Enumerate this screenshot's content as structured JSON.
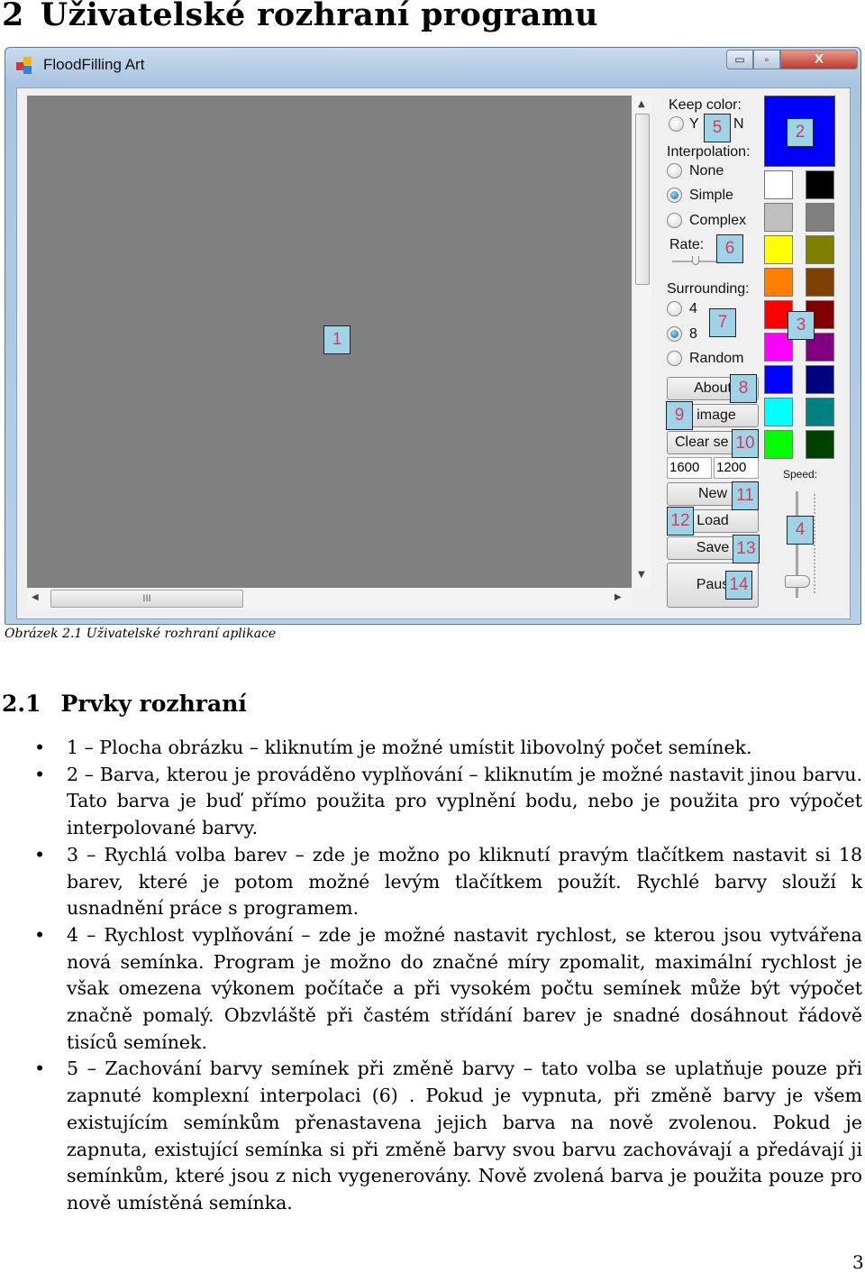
{
  "heading": {
    "number": "2",
    "text": "Uživatelské rozhraní programu"
  },
  "window": {
    "title": "FloodFilling Art",
    "minimize": "▭",
    "maximize": "▫",
    "close": "X",
    "keep_color_label": "Keep color:",
    "keep_y": "Y",
    "keep_n": "N",
    "keep_selected": "none",
    "interpolation_label": "Interpolation:",
    "interp_options": [
      "None",
      "Simple",
      "Complex"
    ],
    "interp_selected": "Simple",
    "rate_label": "Rate:",
    "surrounding_label": "Surrounding:",
    "surround_options": [
      "4",
      "8",
      "Random"
    ],
    "surround_selected": "8",
    "buttons": {
      "about": "About",
      "image": "l image",
      "clear": "Clear se",
      "new": "New",
      "load": "Load",
      "save": "Save",
      "pause": "Paus"
    },
    "width_value": "1600",
    "height_value": "1200",
    "speed_label": "Speed:",
    "hscroll_grip": "III",
    "current_color": "#0000ff",
    "swatches": [
      "#ffffff",
      "#000000",
      "#c0c0c0",
      "#808080",
      "#ffff00",
      "#808000",
      "#ff8000",
      "#804000",
      "#ff0000",
      "#800000",
      "#ff00ff",
      "#800080",
      "#0000ff",
      "#000080",
      "#00ffff",
      "#008080",
      "#00ff00",
      "#004000"
    ],
    "callouts": [
      "1",
      "2",
      "3",
      "4",
      "5",
      "6",
      "7",
      "8",
      "9",
      "10",
      "11",
      "12",
      "13",
      "14"
    ]
  },
  "caption": "Obrázek 2.1  Uživatelské rozhraní aplikace",
  "section": {
    "number": "2.1",
    "text": "Prvky rozhraní"
  },
  "items": [
    "1 – Plocha obrázku – kliknutím je možné umístit libovolný počet semínek.",
    "2 – Barva, kterou je prováděno vyplňování – kliknutím je možné nastavit jinou barvu. Tato barva je buď přímo použita pro vyplnění bodu, nebo je použita pro výpočet interpolované barvy.",
    "3 – Rychlá volba barev – zde je možno po kliknutí pravým tlačítkem nastavit si 18 barev, které je potom možné levým tlačítkem použít. Rychlé barvy slouží k usnadnění práce s programem.",
    "4 – Rychlost vyplňování – zde je možné nastavit rychlost, se kterou jsou vytvářena nová semínka. Program je možno do značné míry zpomalit, maximální rychlost je však omezena výkonem počítače a při vysokém počtu semínek může být výpočet značně pomalý. Obzvláště při častém střídání barev je snadné dosáhnout řádově tisíců semínek.",
    "5 – Zachování barvy semínek při změně barvy – tato volba se uplatňuje pouze při zapnuté komplexní interpolaci (6) . Pokud je vypnuta, při změně barvy je všem existujícím semínkům přenastavena jejich barva na nově zvolenou. Pokud je zapnuta, existující semínka si při změně barvy svou barvu zachovávají a předávají ji semínkům, které jsou z nich vygenerovány. Nově zvolená barva je použita pouze pro nově umístěná semínka."
  ],
  "page_number": "3"
}
